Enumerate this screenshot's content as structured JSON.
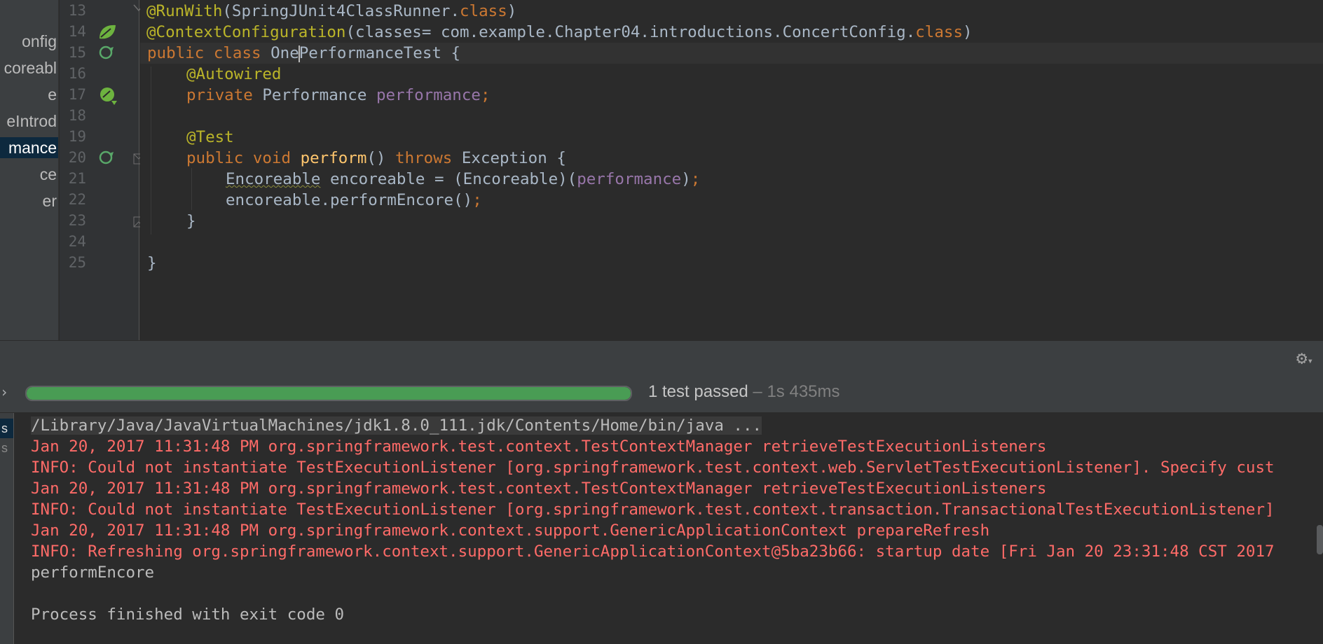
{
  "tree": {
    "items": [
      {
        "label": "onfig",
        "selected": false
      },
      {
        "label": "coreabl",
        "selected": false
      },
      {
        "label": "e",
        "selected": false
      },
      {
        "label": "eIntrod",
        "selected": false
      },
      {
        "label": "mance",
        "selected": true
      },
      {
        "label": "ce",
        "selected": false
      },
      {
        "label": "er",
        "selected": false
      }
    ]
  },
  "editor": {
    "line_numbers": [
      "13",
      "14",
      "15",
      "16",
      "17",
      "18",
      "19",
      "20",
      "21",
      "22",
      "23",
      "24",
      "25"
    ],
    "code": {
      "l13": {
        "ann": "@RunWith",
        "p1": "(SpringJUnit4ClassRunner.",
        "kw": "class",
        "p2": ")"
      },
      "l14": {
        "ann": "@ContextConfiguration",
        "p1": "(classes= com.example.Chapter04.introductions.ConcertConfig.",
        "kw": "class",
        "p2": ")"
      },
      "l15": {
        "kw": "public class ",
        "name_a": "One",
        "name_b": "PerformanceTest",
        "p1": " {"
      },
      "l16": {
        "ann": "@Autowired"
      },
      "l17": {
        "kw": "private ",
        "type": "Performance ",
        "field": "performance",
        "semi": ";"
      },
      "l19": {
        "ann": "@Test"
      },
      "l20": {
        "kw1": "public void ",
        "meth": "perform",
        "p1": "() ",
        "kw2": "throws ",
        "p2": "Exception {"
      },
      "l21": {
        "type": "Encoreable",
        "p1": " encoreable = (Encoreable)(",
        "field": "performance",
        "p2": ")",
        "semi": ";"
      },
      "l22": {
        "p1": "encoreable.performEncore()",
        "semi": ";"
      },
      "l23": {
        "p1": "}"
      },
      "l25": {
        "p1": "}"
      }
    }
  },
  "run": {
    "progress": 1.0,
    "status_text": "1 test passed",
    "duration": " – 1s 435ms"
  },
  "console": {
    "side_tabs": [
      "s",
      "s"
    ],
    "lines": [
      {
        "kind": "cmd",
        "text": "/Library/Java/JavaVirtualMachines/jdk1.8.0_111.jdk/Contents/Home/bin/java ..."
      },
      {
        "kind": "err",
        "text": "Jan 20, 2017 11:31:48 PM org.springframework.test.context.TestContextManager retrieveTestExecutionListeners"
      },
      {
        "kind": "err",
        "text": "INFO: Could not instantiate TestExecutionListener [org.springframework.test.context.web.ServletTestExecutionListener]. Specify cust"
      },
      {
        "kind": "err",
        "text": "Jan 20, 2017 11:31:48 PM org.springframework.test.context.TestContextManager retrieveTestExecutionListeners"
      },
      {
        "kind": "err",
        "text": "INFO: Could not instantiate TestExecutionListener [org.springframework.test.context.transaction.TransactionalTestExecutionListener]"
      },
      {
        "kind": "err",
        "text": "Jan 20, 2017 11:31:48 PM org.springframework.context.support.GenericApplicationContext prepareRefresh"
      },
      {
        "kind": "err",
        "text": "INFO: Refreshing org.springframework.context.support.GenericApplicationContext@5ba23b66: startup date [Fri Jan 20 23:31:48 CST 2017"
      },
      {
        "kind": "out",
        "text": "performEncore"
      },
      {
        "kind": "out",
        "text": ""
      },
      {
        "kind": "out",
        "text": "Process finished with exit code 0"
      }
    ]
  },
  "icons": {
    "spring_bean": "spring-leaf-icon",
    "run_test": "run-test-icon",
    "autowired_nav": "autowired-navigate-icon",
    "settings": "gear-icon"
  },
  "colors": {
    "keyword": "#cc7832",
    "annotation": "#bbb529",
    "field": "#9876aa",
    "method": "#ffc66d",
    "error_text": "#ff6b68",
    "progress_green": "#499c54"
  }
}
